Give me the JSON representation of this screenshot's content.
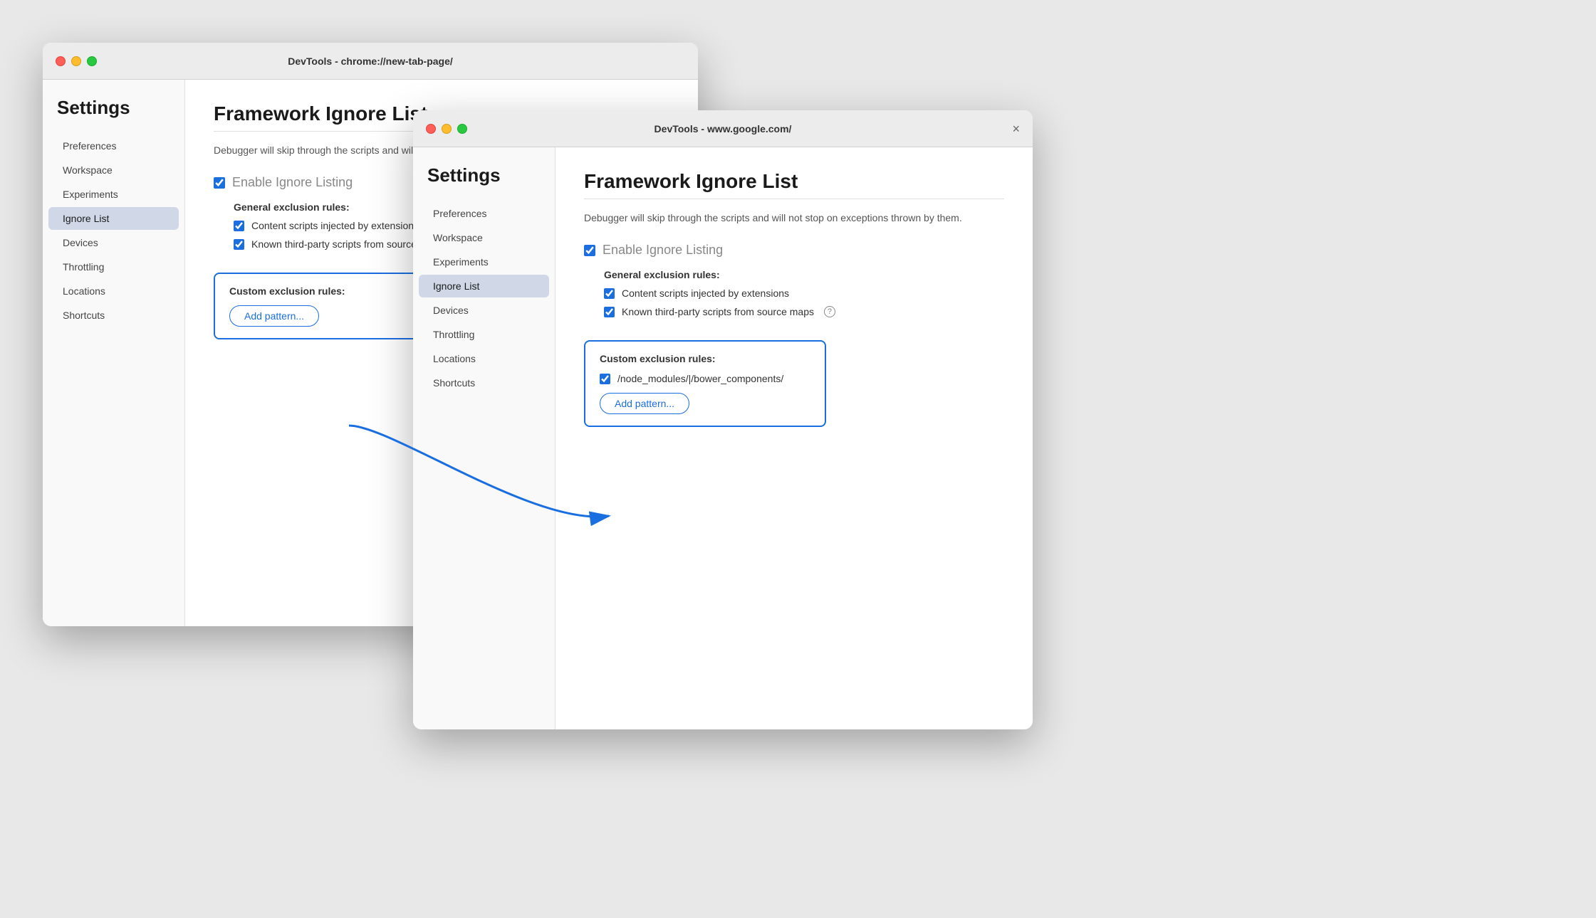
{
  "window1": {
    "title": "DevTools - chrome://new-tab-page/",
    "sidebar": {
      "heading": "Settings",
      "items": [
        {
          "label": "Preferences",
          "active": false
        },
        {
          "label": "Workspace",
          "active": false
        },
        {
          "label": "Experiments",
          "active": false
        },
        {
          "label": "Ignore List",
          "active": true
        },
        {
          "label": "Devices",
          "active": false
        },
        {
          "label": "Throttling",
          "active": false
        },
        {
          "label": "Locations",
          "active": false
        },
        {
          "label": "Shortcuts",
          "active": false
        }
      ]
    },
    "main": {
      "section_title": "Framework Ignore List",
      "section_desc": "Debugger will skip through the scripts and will not stop on exceptions thrown by them.",
      "enable_label": "Enable Ignore Listing",
      "general_rules_header": "General exclusion rules:",
      "rule1": "Content scripts injected by extensions",
      "rule2": "Known third-party scripts from source maps",
      "custom_rules_header": "Custom exclusion rules:",
      "add_pattern_label": "Add pattern..."
    }
  },
  "window2": {
    "title": "DevTools - www.google.com/",
    "sidebar": {
      "heading": "Settings",
      "items": [
        {
          "label": "Preferences",
          "active": false
        },
        {
          "label": "Workspace",
          "active": false
        },
        {
          "label": "Experiments",
          "active": false
        },
        {
          "label": "Ignore List",
          "active": true
        },
        {
          "label": "Devices",
          "active": false
        },
        {
          "label": "Throttling",
          "active": false
        },
        {
          "label": "Locations",
          "active": false
        },
        {
          "label": "Shortcuts",
          "active": false
        }
      ]
    },
    "main": {
      "section_title": "Framework Ignore List",
      "section_desc": "Debugger will skip through the scripts and will not stop on exceptions thrown by them.",
      "enable_label": "Enable Ignore Listing",
      "general_rules_header": "General exclusion rules:",
      "rule1": "Content scripts injected by extensions",
      "rule2": "Known third-party scripts from source maps",
      "custom_rules_header": "Custom exclusion rules:",
      "custom_rule1": "/node_modules/|/bower_components/",
      "add_pattern_label": "Add pattern..."
    }
  },
  "close_label": "×",
  "help_icon_label": "?"
}
